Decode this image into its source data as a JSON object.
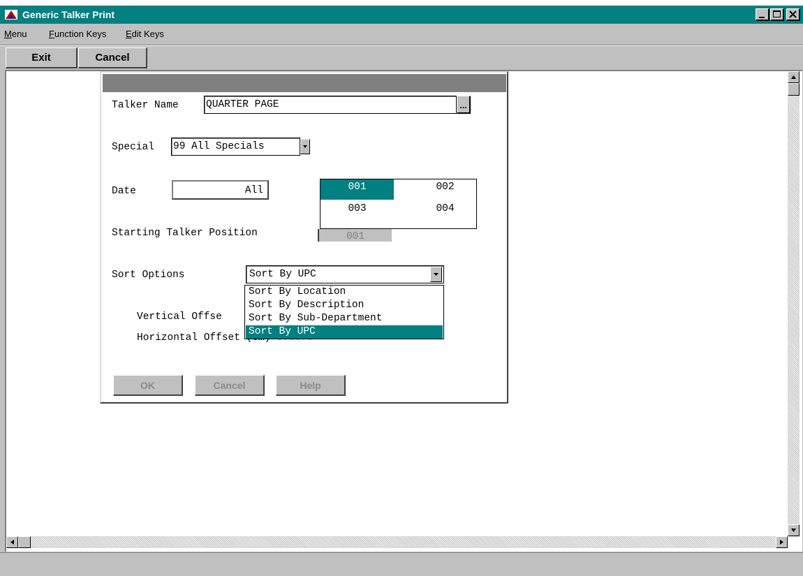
{
  "window": {
    "title": "Generic Talker Print",
    "minimize_glyph": "_",
    "maximize_glyph": "□",
    "close_glyph": "✕"
  },
  "menu": {
    "items": [
      {
        "underline": "M",
        "rest": "enu"
      },
      {
        "underline": "F",
        "rest": "unction Keys"
      },
      {
        "underline": "E",
        "rest": "dit Keys"
      }
    ]
  },
  "toolbar": {
    "exit_label": "Exit",
    "cancel_label": "Cancel"
  },
  "dialog": {
    "talker_name_label": "Talker Name",
    "talker_name_value": "QUARTER PAGE",
    "browse_label": "...",
    "special_label": "Special",
    "special_value": "99 All Specials",
    "date_label": "Date",
    "date_value": "All",
    "position_grid": [
      [
        "001",
        "002"
      ],
      [
        "003",
        "004"
      ]
    ],
    "position_selected": "001",
    "starting_position_label": "Starting Talker Position",
    "starting_position_value": "001",
    "sort_label": "Sort Options",
    "sort_value": "Sort By UPC",
    "sort_options": [
      "Sort By Location",
      "Sort By Description",
      "Sort By Sub-Department",
      "Sort By UPC"
    ],
    "sort_selected_index": 3,
    "vertical_offset_label": "Vertical Offse",
    "horizontal_offset_label": "Horizontal Off",
    "horizontal_offset_tail": "set (cm)",
    "horizontal_offset_value": "0.3970",
    "ok_label": "OK",
    "cancel_label": "Cancel",
    "help_label": "Help"
  },
  "colors": {
    "title_bar": "#008080",
    "selection": "#008080",
    "face": "#c0c0c0"
  }
}
